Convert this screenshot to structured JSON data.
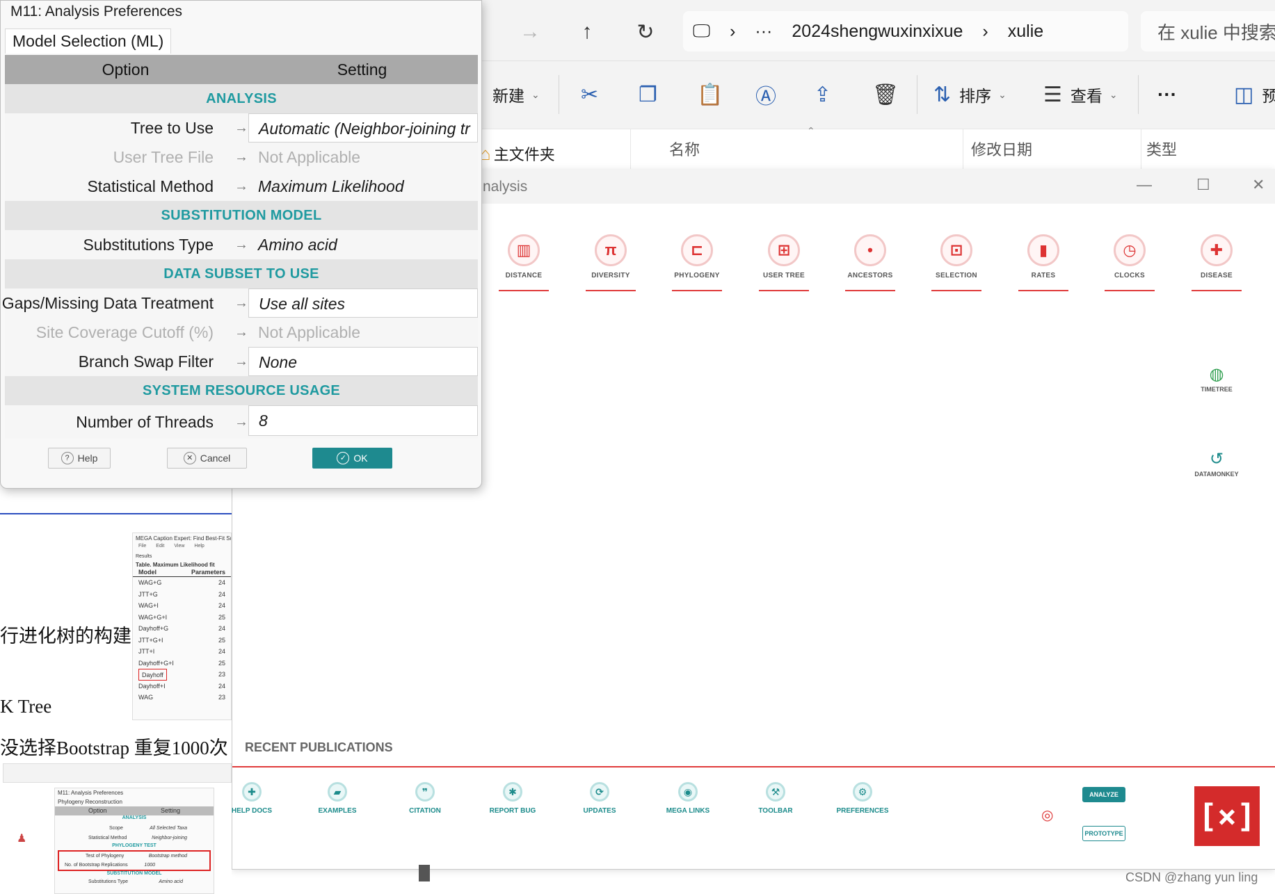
{
  "explorer": {
    "address": {
      "ellipsis": "···",
      "crumbs": [
        "2024shengwuxinxixue",
        "xulie"
      ],
      "separator": "›"
    },
    "search_placeholder": "在 xulie 中搜索",
    "toolbar": {
      "new_label": "新建",
      "sort_label": "排序",
      "view_label": "查看",
      "more_label": "···",
      "preview_label": "预"
    },
    "columns": [
      "名称",
      "修改日期",
      "类型"
    ],
    "home_folder": "主文件夹"
  },
  "mega": {
    "title_fragment": "nalysis",
    "tiles": [
      {
        "label": "DISTANCE",
        "glyph": "▥"
      },
      {
        "label": "DIVERSITY",
        "glyph": "π"
      },
      {
        "label": "PHYLOGENY",
        "glyph": "⊏"
      },
      {
        "label": "USER TREE",
        "glyph": "⊞"
      },
      {
        "label": "ANCESTORS",
        "glyph": "•"
      },
      {
        "label": "SELECTION",
        "glyph": "⊡"
      },
      {
        "label": "RATES",
        "glyph": "▮"
      },
      {
        "label": "CLOCKS",
        "glyph": "◷"
      },
      {
        "label": "DISEASE",
        "glyph": "✚"
      }
    ],
    "side_tools": [
      {
        "label": "TIMETREE",
        "glyph": "◍"
      },
      {
        "label": "DATAMONKEY",
        "glyph": "↺"
      }
    ],
    "recent_publications": "RECENT PUBLICATIONS",
    "bottom_tools": [
      {
        "label": "HELP DOCS",
        "glyph": "✚"
      },
      {
        "label": "EXAMPLES",
        "glyph": "▰"
      },
      {
        "label": "CITATION",
        "glyph": "❞"
      },
      {
        "label": "REPORT BUG",
        "glyph": "✱"
      },
      {
        "label": "UPDATES",
        "glyph": "⟳"
      },
      {
        "label": "MEGA LINKS",
        "glyph": "◉"
      },
      {
        "label": "TOOLBAR",
        "glyph": "⚒"
      },
      {
        "label": "PREFERENCES",
        "glyph": "⚙"
      }
    ],
    "analyze_badge": "ANALYZE",
    "prototype_badge": "PROTOTYPE",
    "logo_text": "[×]"
  },
  "document": {
    "line1": "行进化树的构建",
    "line2": "K Tree",
    "line3": "没选择Bootstrap 重复1000次",
    "mini1": {
      "title": "MEGA Caption Expert: Find Best-Fit Sub",
      "menu": [
        "File",
        "Edit",
        "View",
        "Help"
      ],
      "results": "Results",
      "table_title": "Table. Maximum Likelihood fit",
      "headers": [
        "Model",
        "Parameters"
      ],
      "rows": [
        [
          "WAG+G",
          "24"
        ],
        [
          "JTT+G",
          "24"
        ],
        [
          "WAG+I",
          "24"
        ],
        [
          "WAG+G+I",
          "25"
        ],
        [
          "Dayhoff+G",
          "24"
        ],
        [
          "JTT+G+I",
          "25"
        ],
        [
          "JTT+I",
          "24"
        ],
        [
          "Dayhoff+G+I",
          "25"
        ],
        [
          "Dayhoff",
          "23"
        ],
        [
          "Dayhoff+I",
          "24"
        ],
        [
          "WAG",
          "23"
        ]
      ]
    },
    "mini2": {
      "title": "M11: Analysis Preferences",
      "tab": "Phylogeny Reconstruction",
      "headers": [
        "Option",
        "Setting"
      ],
      "section1": "ANALYSIS",
      "scope": [
        "Scope",
        "All Selected Taxa"
      ],
      "method": [
        "Statistical Method",
        "Neighbor-joining"
      ],
      "section2": "PHYLOGENY TEST",
      "test": [
        "Test of Phylogeny",
        "Bootstrap method"
      ],
      "reps": [
        "No. of Bootstrap Replications",
        "1000"
      ],
      "section3": "SUBSTITUTION MODEL",
      "subst": [
        "Substitutions Type",
        "Amino acid"
      ]
    }
  },
  "dialog": {
    "title": "M11: Analysis Preferences",
    "tab": "Model Selection (ML)",
    "headers": {
      "option": "Option",
      "setting": "Setting"
    },
    "arrow": "→",
    "sections": {
      "analysis": "ANALYSIS",
      "substitution": "SUBSTITUTION MODEL",
      "subset": "DATA SUBSET TO USE",
      "system": "SYSTEM RESOURCE USAGE"
    },
    "rows": {
      "tree_to_use": {
        "label": "Tree to Use",
        "value": "Automatic (Neighbor-joining tr"
      },
      "user_tree_file": {
        "label": "User Tree File",
        "value": "Not Applicable"
      },
      "statistical_method": {
        "label": "Statistical Method",
        "value": "Maximum Likelihood"
      },
      "substitutions_type": {
        "label": "Substitutions Type",
        "value": "Amino acid"
      },
      "gaps": {
        "label": "Gaps/Missing Data Treatment",
        "value": "Use all sites"
      },
      "site_coverage": {
        "label": "Site Coverage Cutoff (%)",
        "value": "Not Applicable"
      },
      "branch_swap": {
        "label": "Branch Swap Filter",
        "value": "None"
      },
      "threads": {
        "label": "Number of Threads",
        "value": "8"
      }
    },
    "buttons": {
      "help": "Help",
      "cancel": "Cancel",
      "ok": "OK"
    }
  },
  "watermark": "CSDN @zhang yun ling"
}
